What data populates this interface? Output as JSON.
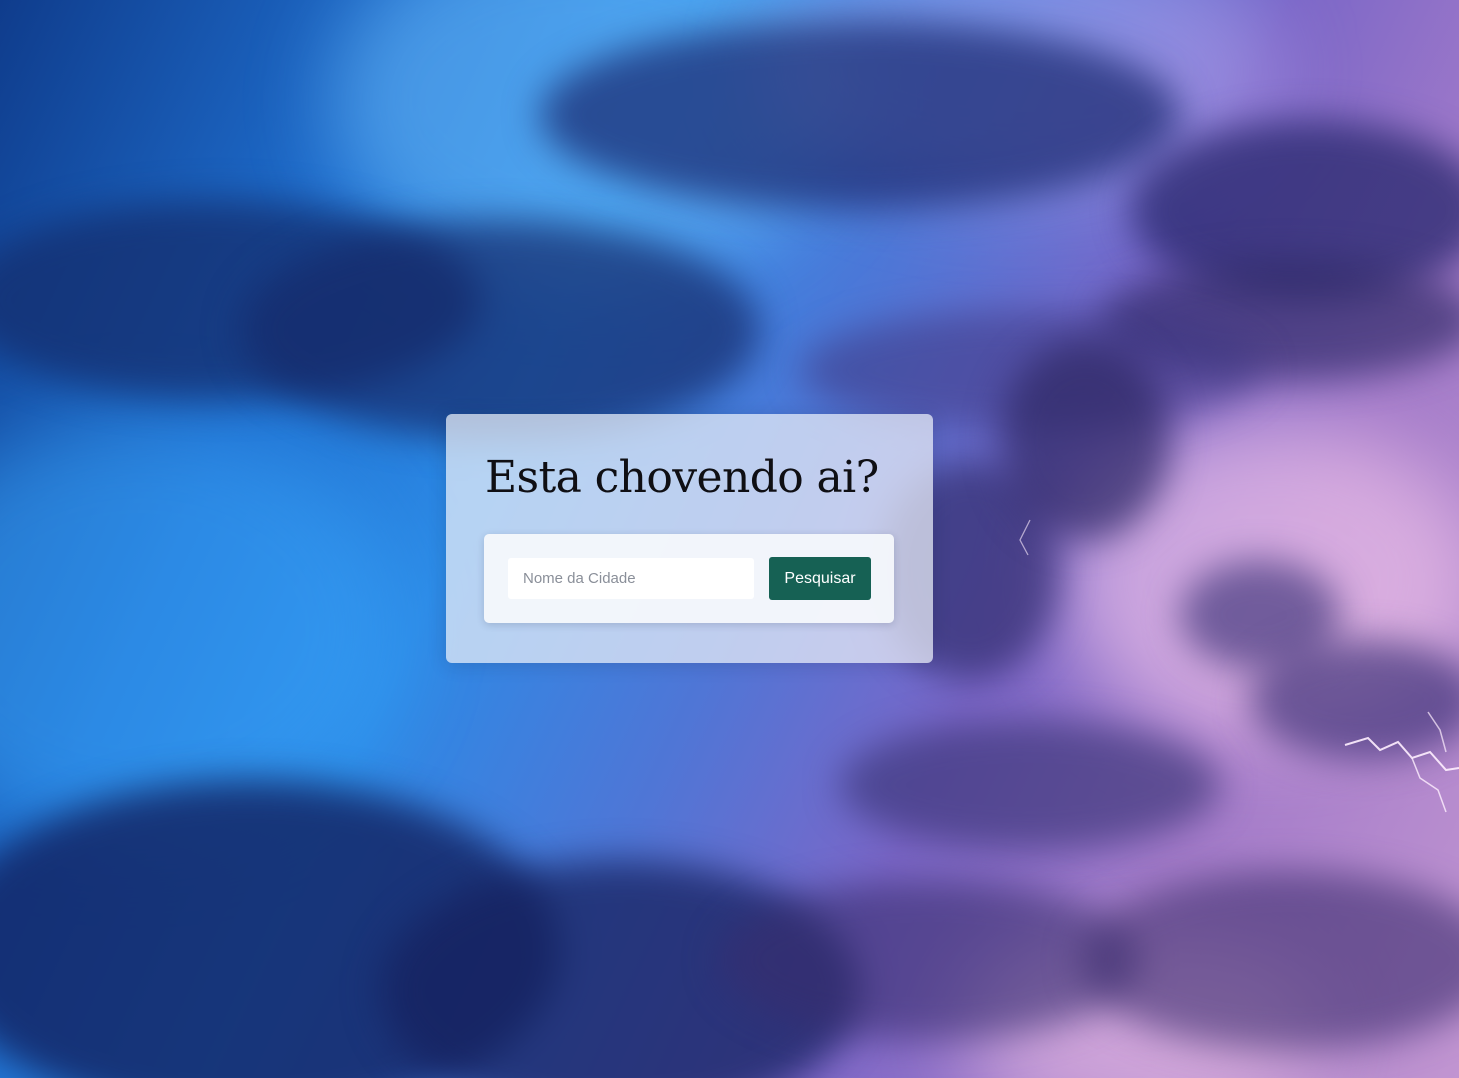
{
  "background": {
    "description_icon": "storm-clouds-lightning-image",
    "colors": {
      "deep_blue": "#0f3c8c",
      "bright_blue": "#2c8ae6",
      "violet": "#7b67c8",
      "pink": "#c195d1"
    }
  },
  "card": {
    "title": "Esta chovendo ai?"
  },
  "search": {
    "placeholder": "Nome da Cidade",
    "value": "",
    "button_label": "Pesquisar",
    "button_color": "#166154"
  }
}
